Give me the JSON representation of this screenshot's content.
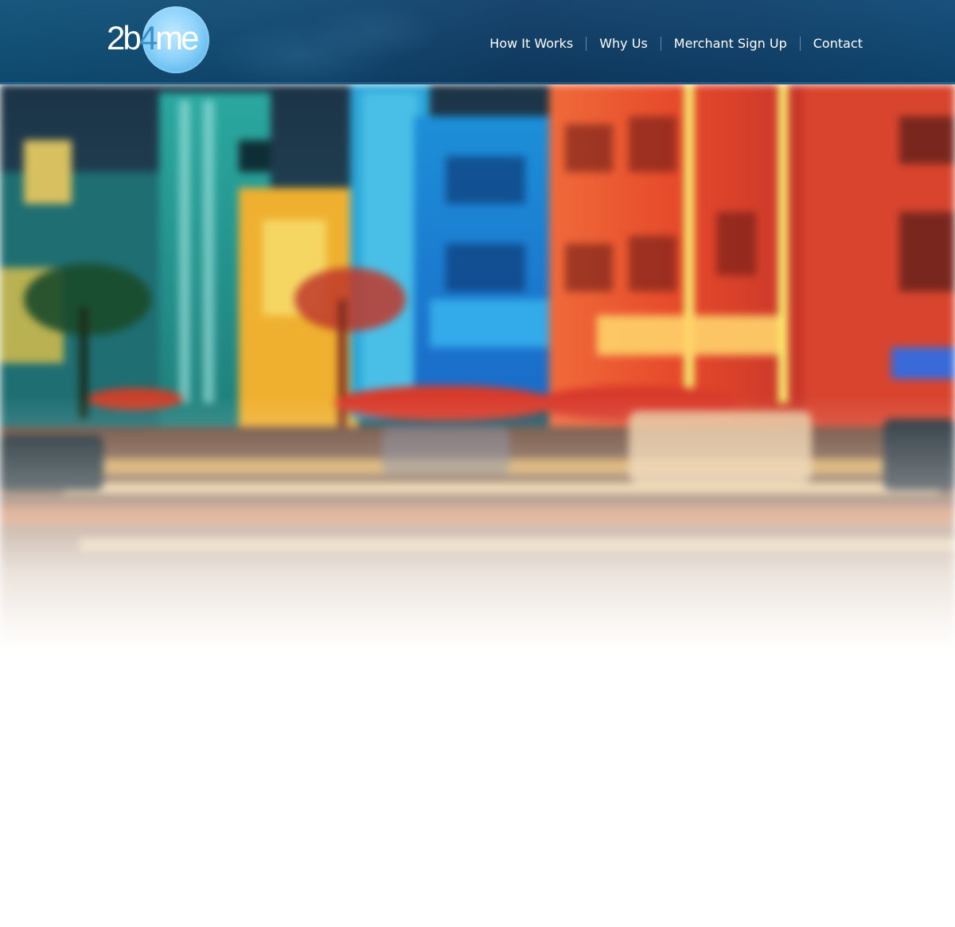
{
  "logo": {
    "text_2": "2",
    "text_b": "b",
    "text_4": "4",
    "text_me": "me"
  },
  "nav": {
    "items": [
      {
        "label": "How It Works"
      },
      {
        "label": "Why Us"
      },
      {
        "label": "Merchant Sign Up"
      },
      {
        "label": "Contact"
      }
    ]
  },
  "hero": {
    "image": "blurred-night-street-hotels-neon-photo"
  },
  "colors": {
    "header": "#0f4570",
    "logo_circle": "#8fd3fb",
    "logo_four": "#3a8fc8",
    "nav_text": "#ffffff"
  }
}
